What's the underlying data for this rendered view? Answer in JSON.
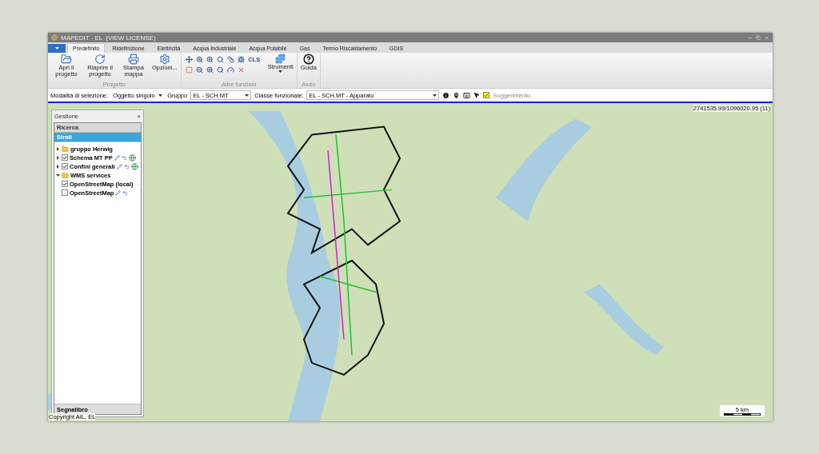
{
  "window": {
    "title": "MAPEDIT - EL",
    "license": "(VIEW LICENSE)"
  },
  "tabs": [
    {
      "label": "Predefinito",
      "selected": true
    },
    {
      "label": "Ridefinizione",
      "selected": false
    },
    {
      "label": "Elettricità",
      "selected": false
    },
    {
      "label": "Acqua Industriale",
      "selected": false
    },
    {
      "label": "Acqua Potabile",
      "selected": false
    },
    {
      "label": "Gas",
      "selected": false
    },
    {
      "label": "Termo Riscaldamento",
      "selected": false
    },
    {
      "label": "GDIS",
      "selected": false
    }
  ],
  "ribbon": {
    "groups": [
      {
        "label": "Progetto",
        "kind": "large",
        "buttons": [
          "Apri il progetto",
          "Riaprire il progetto",
          "Stampa mappa",
          "Opzioni..."
        ]
      },
      {
        "label": "Altre funzioni",
        "kind": "tools",
        "tool_text": "CLS",
        "buttons": [
          "Strumenti"
        ]
      },
      {
        "label": "Aiuto",
        "kind": "large",
        "buttons": [
          "Guida"
        ]
      }
    ]
  },
  "selection_bar": {
    "mode_label": "Modalità di selezione:",
    "mode_value": "Oggetto singolo",
    "group_label": "Gruppo",
    "group_value": "EL - SCH.MT",
    "class_label": "Classe funzionale:",
    "class_value": "EL - SCH.MT - Apparato",
    "suggest": {
      "label": "Suggerimento",
      "checked": true
    }
  },
  "panel": {
    "title": "Gestione",
    "close": "×",
    "sections": [
      {
        "label": "Ricerca",
        "selected": false
      },
      {
        "label": "Strati",
        "selected": true
      }
    ],
    "layers": [
      {
        "label": "gruppo Herwig",
        "kind": "folder",
        "expanded": false
      },
      {
        "label": "Schema MT PP",
        "kind": "source",
        "checked": true,
        "expanded": false
      },
      {
        "label": "Confini generali",
        "kind": "source",
        "checked": true,
        "expanded": false
      },
      {
        "label": "WMS services",
        "kind": "folder",
        "expanded": true,
        "children": [
          {
            "label": "OpenStreetMap (local)",
            "kind": "layer",
            "checked": true
          },
          {
            "label": "OpenStreetMap",
            "kind": "layer",
            "checked": false
          }
        ]
      }
    ],
    "footer": "Segnalibro"
  },
  "map": {
    "coordinates": "2741535.99/1096020.95 (11)",
    "scale": "5 km",
    "copyright": "Copyright AIL, EL"
  }
}
